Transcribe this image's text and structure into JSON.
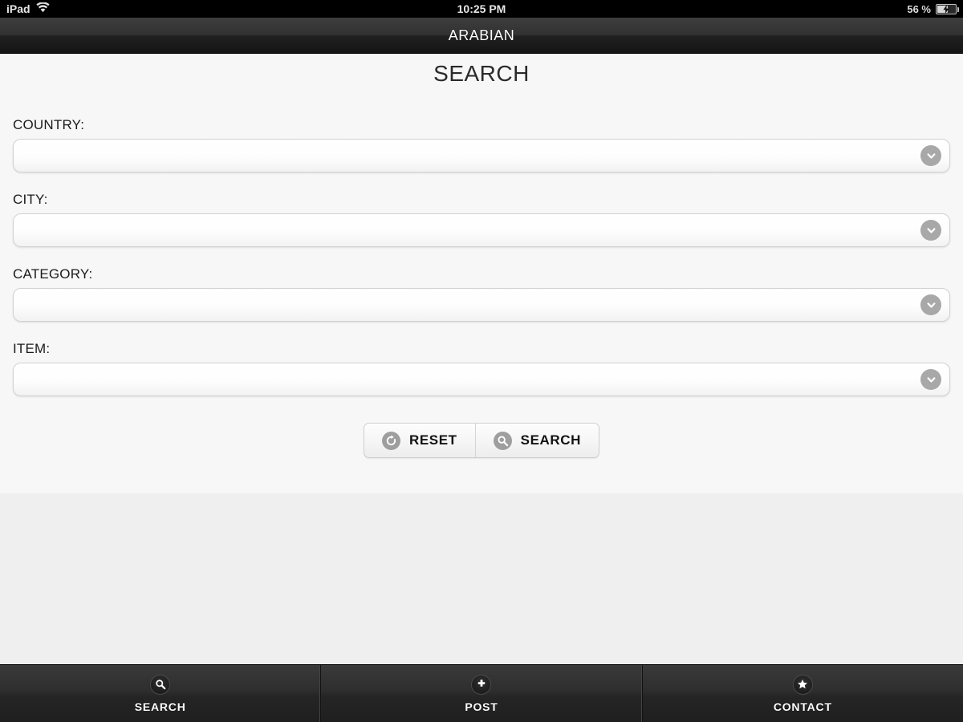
{
  "status_bar": {
    "carrier": "iPad",
    "wifi_icon": "wifi-icon",
    "time": "10:25 PM",
    "battery_percent": "56 %",
    "battery_icon": "battery-charging-icon"
  },
  "navbar": {
    "title": "ARABIAN"
  },
  "page": {
    "title": "SEARCH"
  },
  "form": {
    "fields": [
      {
        "label": "COUNTRY:",
        "value": "",
        "name": "country",
        "chevron_icon": "chevron-down-icon"
      },
      {
        "label": "CITY:",
        "value": "",
        "name": "city",
        "chevron_icon": "chevron-down-icon"
      },
      {
        "label": "CATEGORY:",
        "value": "",
        "name": "category",
        "chevron_icon": "chevron-down-icon"
      },
      {
        "label": "ITEM:",
        "value": "",
        "name": "item",
        "chevron_icon": "chevron-down-icon"
      }
    ],
    "buttons": [
      {
        "label": "RESET",
        "icon": "refresh-icon"
      },
      {
        "label": "SEARCH",
        "icon": "search-icon"
      }
    ]
  },
  "tabbar": {
    "tabs": [
      {
        "label": "SEARCH",
        "icon": "search-icon"
      },
      {
        "label": "POST",
        "icon": "plus-icon"
      },
      {
        "label": "CONTACT",
        "icon": "star-icon"
      }
    ]
  },
  "colors": {
    "navbar_dark": "#1f1f1f",
    "content_bg": "#f7f7f7",
    "filler_bg": "#efefef",
    "chevron_gray": "#a8a8a8",
    "tabbar_dark": "#2e2e2e"
  }
}
